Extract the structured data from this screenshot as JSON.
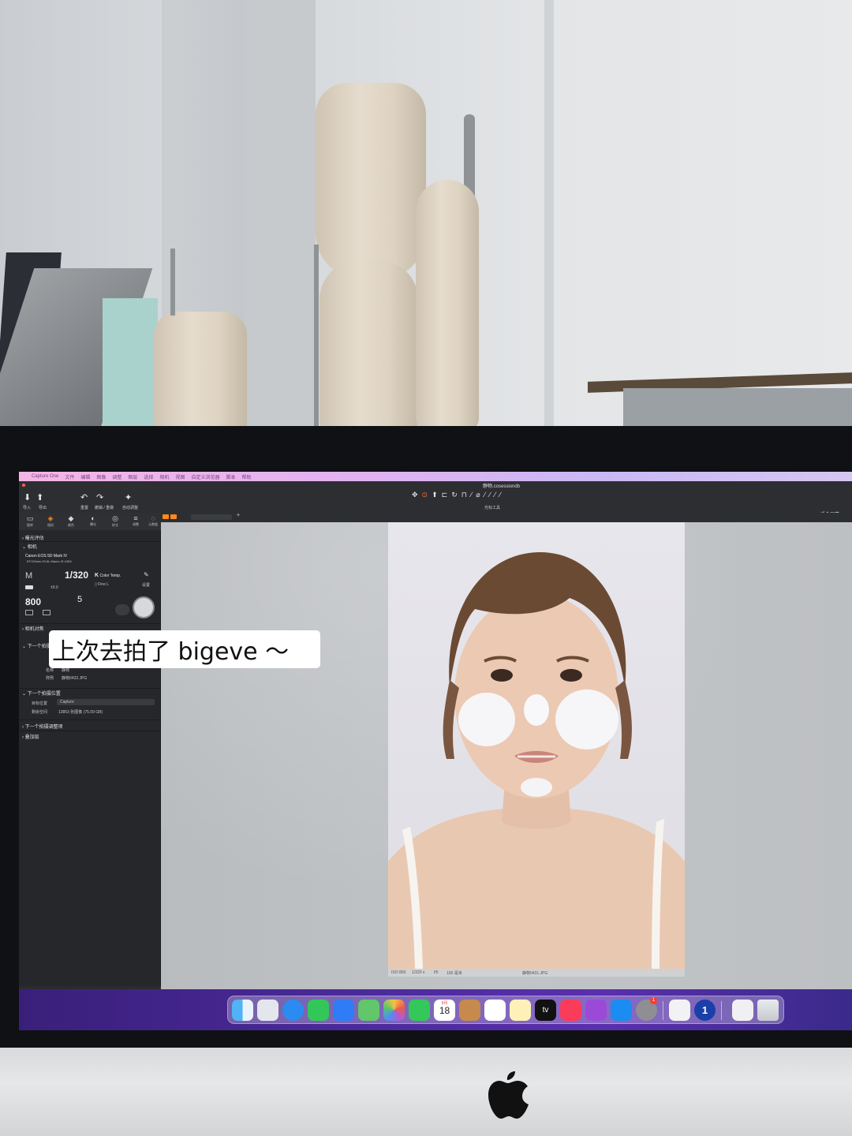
{
  "menubar": {
    "items": [
      "Capture One",
      "文件",
      "编辑",
      "图像",
      "调整",
      "图层",
      "选择",
      "相机",
      "视图",
      "自定义浏览器",
      "脚本",
      "帮助"
    ]
  },
  "toolbar": {
    "import_label": "导入",
    "export_label": "导出",
    "undo_label": "重置",
    "reset_label": "撤销 / 重做",
    "auto_label": "自动调整",
    "cursor_tools_label": "光标工具",
    "session_title": "静物.cosessiondb",
    "fit_screen": "适合屏幕"
  },
  "leftpanel": {
    "tabs": [
      "图库",
      "相机",
      "颜色",
      "曝光",
      "样式",
      "调整",
      "元数据"
    ],
    "exposure_eval": "曝光评估",
    "camera_section": "相机",
    "camera_model": "Canon EOS 5D Mark IV",
    "lens_model": "EF100mm f/2.8L Macro IS USM",
    "mode": "M",
    "shutter": "1/320",
    "exposure_comp": "±0.0",
    "iso": "800",
    "aperture": "5",
    "wb_label": "Color Temp.",
    "quality_label": "Fine L",
    "settings_label": "设置",
    "camera_focus": "相机对焦",
    "next_capture_naming": "下一个拍摄命名",
    "name_label": "名称",
    "name_value": "静物",
    "sample_label": "样例",
    "sample_value": "静物0432.JPG",
    "next_capture_location": "下一个拍摄位置",
    "destination_label": "目标位置",
    "destination_value": "Capture",
    "space_label": "剩余空间",
    "space_value": "13853 张图像 (75.09 GB)",
    "next_capture_adjust": "下一个拍摄调整项",
    "overlay": "叠加层"
  },
  "viewer": {
    "photo_filename": "静物0431.JPG",
    "photo_iso": "ISO 800",
    "photo_shutter": "1/320 s",
    "photo_aperture": "f/5",
    "photo_focal": "100 毫米"
  },
  "dock": {
    "calendar_month": "9月",
    "calendar_day": "18",
    "tv_label": "tv",
    "onepass_label": "1",
    "notification_badge": "1"
  },
  "caption": {
    "text": "上次去拍了 bigeve ～"
  },
  "colors": {
    "accent_orange": "#ff8a1a",
    "dock_wallpaper": "#4a2a9a",
    "menubar_pink": "#f3b6e3"
  }
}
